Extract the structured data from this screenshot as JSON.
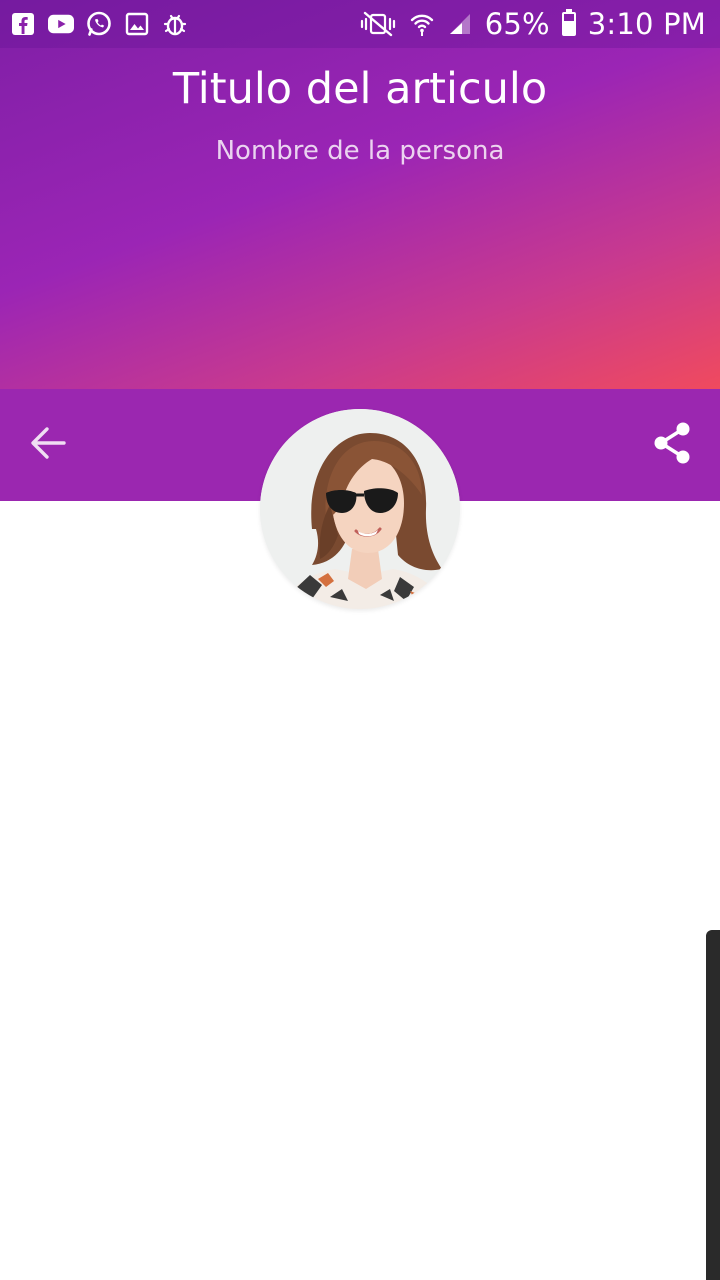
{
  "status_bar": {
    "battery": "65%",
    "time": "3:10 PM",
    "icons_left": [
      "facebook-icon",
      "youtube-icon",
      "whatsapp-icon",
      "gallery-icon",
      "bug-icon"
    ],
    "icons_right": [
      "vibrate-off-icon",
      "wifi-icon",
      "signal-icon",
      "battery-icon"
    ]
  },
  "article": {
    "title": "Titulo del articulo",
    "author": "Nombre de la persona"
  },
  "toolbar": {
    "back_icon": "arrow-back-icon",
    "share_icon": "share-icon"
  },
  "colors": {
    "gradient_start": "#7f1fa6",
    "gradient_end": "#f04a5e",
    "toolbar": "#9b27b0"
  }
}
